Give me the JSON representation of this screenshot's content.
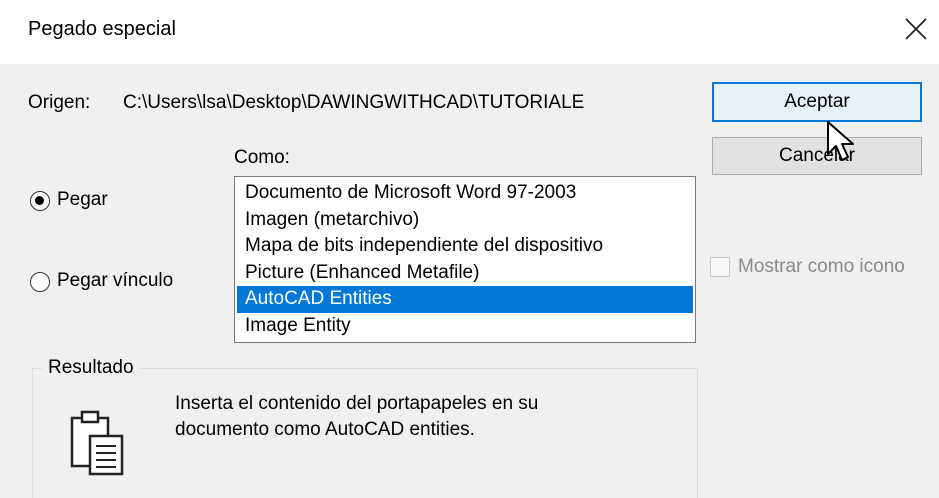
{
  "window": {
    "title": "Pegado especial"
  },
  "origin": {
    "label": "Origen:",
    "path": "C:\\Users\\lsa\\Desktop\\DAWINGWITHCAD\\TUTORIALE"
  },
  "buttons": {
    "accept": "Aceptar",
    "cancel": "Cancelar"
  },
  "como": {
    "label": "Como:",
    "items": [
      "Documento de Microsoft Word 97-2003",
      "Imagen (metarchivo)",
      "Mapa de bits independiente del dispositivo",
      "Picture (Enhanced Metafile)",
      "AutoCAD Entities",
      "Image Entity"
    ],
    "selected": "AutoCAD Entities"
  },
  "paste_options": {
    "paste": "Pegar",
    "paste_link": "Pegar vínculo",
    "selected": "Pegar"
  },
  "show_as_icon": {
    "label": "Mostrar como icono",
    "checked": false,
    "enabled": false
  },
  "result": {
    "title": "Resultado",
    "line1": "Inserta el contenido del portapapeles en su",
    "line2": "documento como AutoCAD entities."
  },
  "colors": {
    "selection": "#0078d7",
    "dialog_bg": "#f0f0f0",
    "primary_border": "#0078d7"
  },
  "icons": [
    "close-icon",
    "clipboard-icon",
    "mouse-cursor-icon"
  ]
}
